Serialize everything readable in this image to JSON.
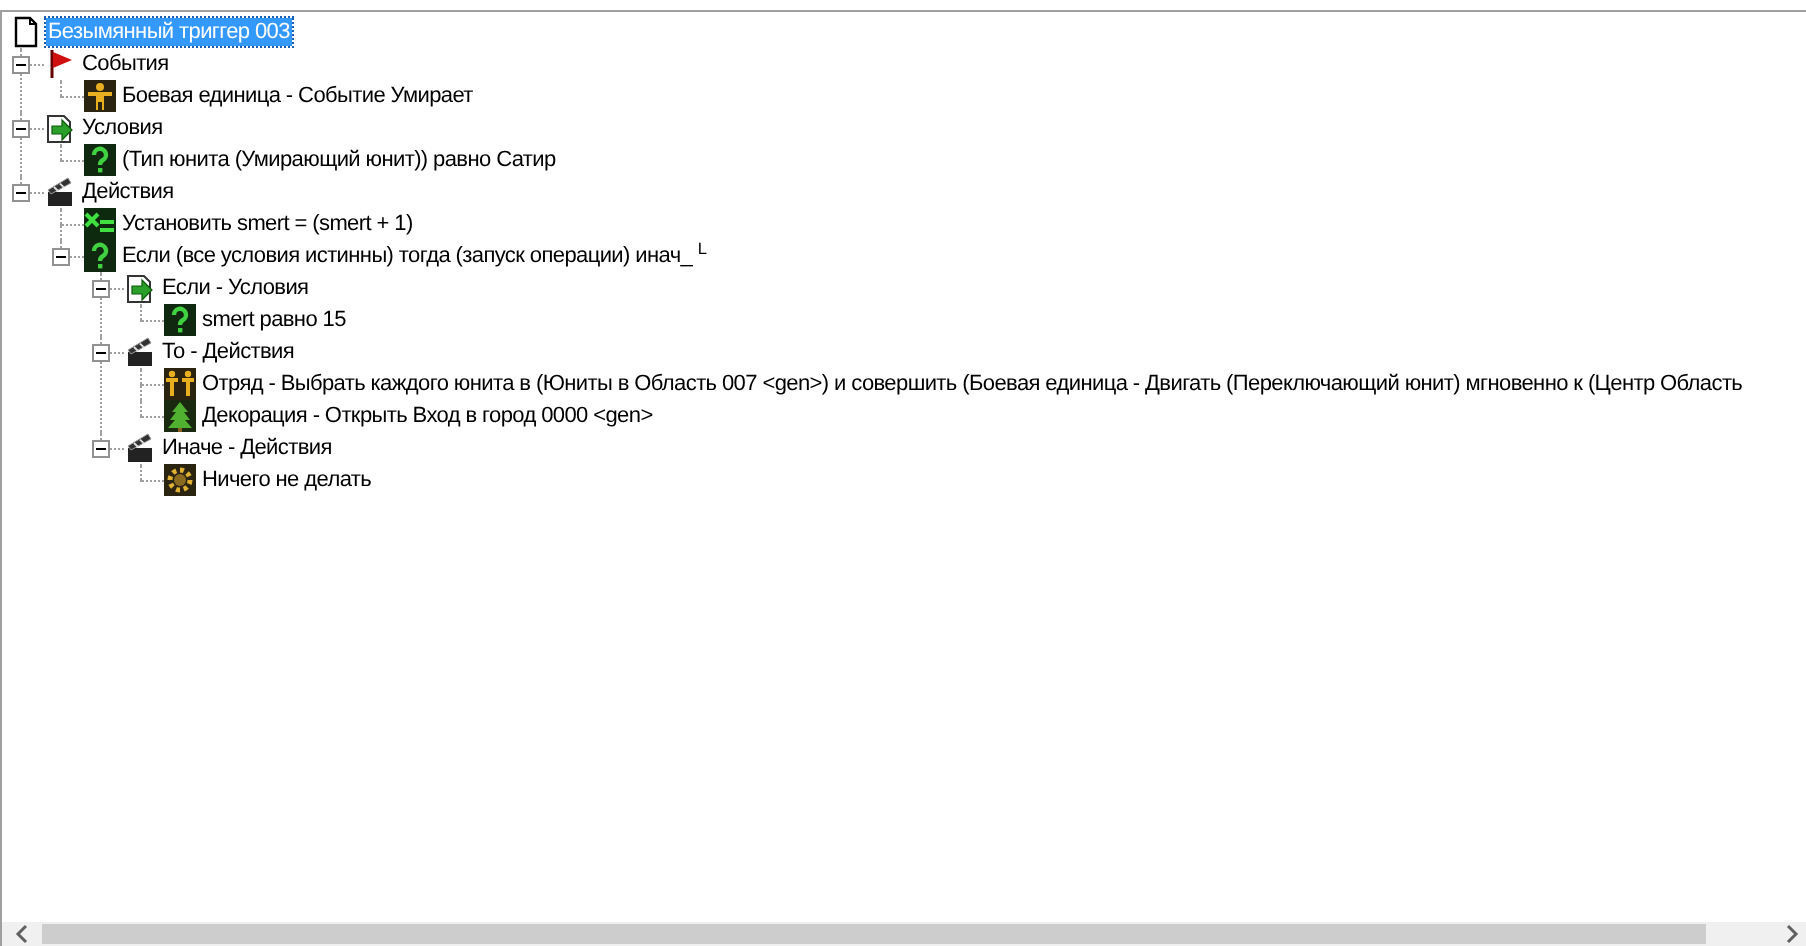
{
  "tree": {
    "label": "Безымянный триггер 003",
    "kind": "document",
    "selected": true,
    "children": [
      {
        "label": "События",
        "kind": "flag",
        "selected": false,
        "expanded": true,
        "children": [
          {
            "label": "Боевая единица - Событие Умирает",
            "kind": "unit",
            "selected": false
          }
        ]
      },
      {
        "label": "Условия",
        "kind": "conditions",
        "selected": false,
        "expanded": true,
        "children": [
          {
            "label": "(Тип юнита (Умирающий юнит)) равно Сатир",
            "kind": "question",
            "selected": false
          }
        ]
      },
      {
        "label": "Действия",
        "kind": "actions",
        "selected": false,
        "expanded": true,
        "children": [
          {
            "label": "Установить smert = (smert + 1)",
            "kind": "variable",
            "selected": false
          },
          {
            "label": "Если (все условия истинны) тогда (запуск операции) инач_ $^{L}$",
            "kind": "question",
            "selected": false,
            "expanded": true,
            "children": [
              {
                "label": "Если - Условия",
                "kind": "conditions",
                "selected": false,
                "expanded": true,
                "children": [
                  {
                    "label": "smert равно 15",
                    "kind": "question",
                    "selected": false
                  }
                ]
              },
              {
                "label": "То - Действия",
                "kind": "actions",
                "selected": false,
                "expanded": true,
                "children": [
                  {
                    "label": "Отряд - Выбрать каждого юнита в (Юниты в Область 007 <gen>) и совершить (Боевая единица - Двигать (Переключающий юнит) мгновенно к (Центр Область",
                    "kind": "group",
                    "selected": false
                  },
                  {
                    "label": "Декорация - Открыть Вход в город 0000 <gen>",
                    "kind": "doodad",
                    "selected": false
                  }
                ]
              },
              {
                "label": "Иначе - Действия",
                "kind": "actions",
                "selected": false,
                "expanded": true,
                "children": [
                  {
                    "label": "Ничего не делать",
                    "kind": "gear",
                    "selected": false
                  }
                ]
              }
            ]
          }
        ]
      }
    ]
  }
}
